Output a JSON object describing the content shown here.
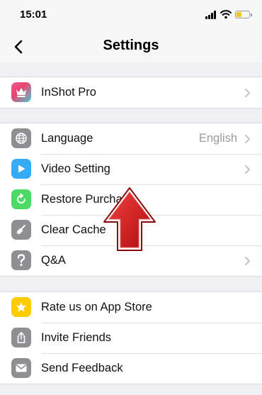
{
  "status_bar": {
    "time": "15:01",
    "battery_level": 0.4,
    "battery_color": "#f2c522"
  },
  "nav": {
    "title": "Settings",
    "back_icon": "chevron-left-icon"
  },
  "groups": [
    {
      "items": [
        {
          "label": "InShot Pro",
          "icon": "crown-icon",
          "icon_color": "#e8466d",
          "has_chevron": true
        }
      ]
    },
    {
      "items": [
        {
          "label": "Language",
          "value": "English",
          "icon": "globe-icon",
          "icon_color": "#8e8e93",
          "has_chevron": true
        },
        {
          "label": "Video Setting",
          "icon": "play-icon",
          "icon_color": "#35aaf5",
          "has_chevron": true
        },
        {
          "label": "Restore Purchase",
          "icon": "restore-icon",
          "icon_color": "#4cd964",
          "has_chevron": false
        },
        {
          "label": "Clear Cache",
          "icon": "broom-icon",
          "icon_color": "#8e8e93",
          "has_chevron": false
        },
        {
          "label": "Q&A",
          "icon": "question-icon",
          "icon_color": "#8e8e93",
          "has_chevron": true
        }
      ]
    },
    {
      "items": [
        {
          "label": "Rate us on App Store",
          "icon": "star-icon",
          "icon_color": "#ffcc00",
          "has_chevron": false
        },
        {
          "label": "Invite Friends",
          "icon": "share-icon",
          "icon_color": "#8e8e93",
          "has_chevron": false
        },
        {
          "label": "Send Feedback",
          "icon": "mail-icon",
          "icon_color": "#8e8e93",
          "has_chevron": false
        }
      ]
    }
  ],
  "overlay": {
    "arrow_icon": "red-up-arrow-icon",
    "arrow_color": "#d41a1a"
  }
}
